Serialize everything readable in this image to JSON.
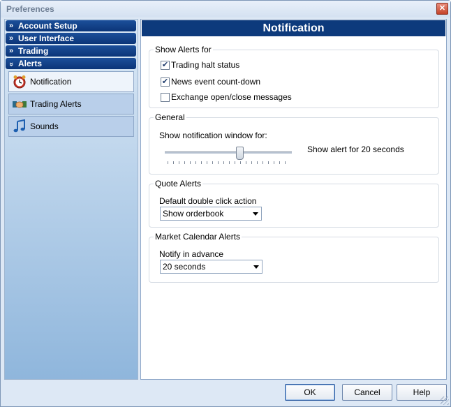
{
  "window": {
    "title": "Preferences"
  },
  "sidebar": {
    "categories": [
      {
        "label": "Account Setup",
        "expanded": false
      },
      {
        "label": "User Interface",
        "expanded": false
      },
      {
        "label": "Trading",
        "expanded": false
      },
      {
        "label": "Alerts",
        "expanded": true
      }
    ],
    "items": [
      {
        "label": "Notification",
        "icon": "alarm-clock-icon",
        "selected": true
      },
      {
        "label": "Trading Alerts",
        "icon": "handshake-icon",
        "selected": false
      },
      {
        "label": "Sounds",
        "icon": "music-note-icon",
        "selected": false
      }
    ]
  },
  "content": {
    "header": "Notification",
    "show_alerts": {
      "label": "Show Alerts for",
      "options": [
        {
          "label": "Trading halt status",
          "checked": true
        },
        {
          "label": "News event count-down",
          "checked": true
        },
        {
          "label": "Exchange open/close messages",
          "checked": false
        }
      ]
    },
    "general": {
      "label": "General",
      "slider_label": "Show notification window for:",
      "slider_value_text": "Show alert for 20 seconds",
      "slider_fraction": 0.59
    },
    "quote_alerts": {
      "label": "Quote Alerts",
      "field_label": "Default double click action",
      "value": "Show orderbook"
    },
    "market_calendar": {
      "label": "Market Calendar Alerts",
      "field_label": "Notify in advance",
      "value": "20 seconds"
    }
  },
  "buttons": {
    "ok": "OK",
    "cancel": "Cancel",
    "help": "Help"
  },
  "colors": {
    "header_bg": "#0d3a7c",
    "category_bg": "#0b3578",
    "sidebar_bottom": "#8fb6dc"
  }
}
